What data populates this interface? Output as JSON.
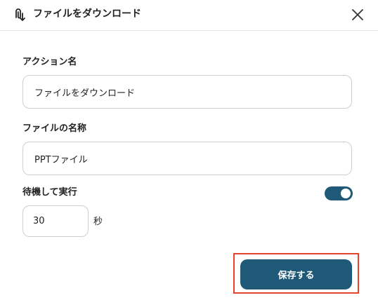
{
  "header": {
    "icon": "paperclip-download-icon",
    "title": "ファイルをダウンロード",
    "close_icon": "close-icon"
  },
  "form": {
    "action_name": {
      "label": "アクション名",
      "value": "ファイルをダウンロード"
    },
    "file_name": {
      "label": "ファイルの名称",
      "value": "PPTファイル"
    },
    "wait": {
      "label": "待機して実行",
      "toggle_on": true,
      "value": "30",
      "unit": "秒"
    }
  },
  "footer": {
    "save_label": "保存する"
  },
  "colors": {
    "accent": "#1e5a78",
    "highlight": "#e8432e",
    "border": "#cfcfcf"
  }
}
